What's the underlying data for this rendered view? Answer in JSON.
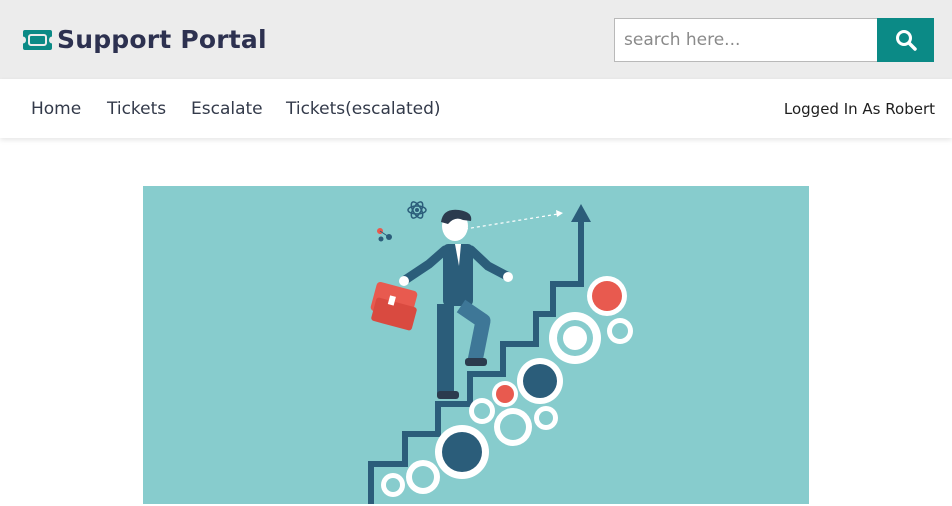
{
  "header": {
    "brand_title": "Support Portal",
    "brand_icon": "ticket-icon",
    "search": {
      "placeholder": "search here...",
      "value": "",
      "icon": "search-icon"
    }
  },
  "nav": {
    "items": [
      {
        "label": "Home"
      },
      {
        "label": "Tickets"
      },
      {
        "label": "Escalate"
      },
      {
        "label": "Tickets(escalated)"
      }
    ],
    "user_label": "Logged In As Robert"
  },
  "hero": {
    "image": "career-growth-illustration"
  },
  "colors": {
    "accent": "#0b8a86",
    "brand_text": "#2d3150",
    "header_bg": "#ececec",
    "hero_bg": "#87cccd"
  }
}
